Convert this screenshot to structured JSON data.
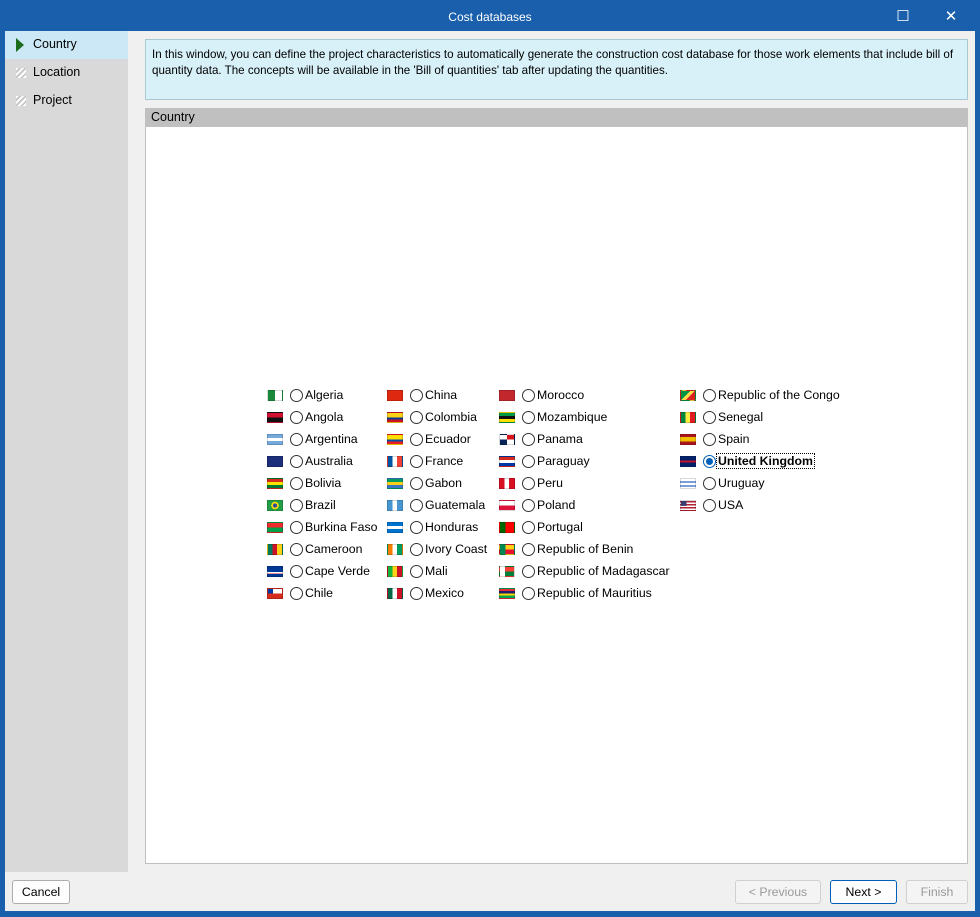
{
  "window": {
    "title": "Cost databases",
    "maximize_icon": "☐",
    "close_icon": "✕"
  },
  "sidebar": {
    "items": [
      {
        "label": "Country",
        "active": true
      },
      {
        "label": "Location"
      },
      {
        "label": "Project"
      }
    ]
  },
  "info_text": "In this window, you can define the project characteristics to automatically generate the construction cost database for those work elements that include bill of quantity data. The concepts will be available in the 'Bill of quantities' tab after updating the quantities.",
  "panel_title": "Country",
  "selected": "United Kingdom",
  "columns": [
    [
      {
        "name": "Algeria",
        "flag": "linear-gradient(90deg,#1a8a3a 50%,#fff 50%)"
      },
      {
        "name": "Angola",
        "flag": "linear-gradient(#d21034 50%,#111 50%)"
      },
      {
        "name": "Argentina",
        "flag": "linear-gradient(#75aadb 33%,#fff 33% 66%,#75aadb 66%)"
      },
      {
        "name": "Australia",
        "flag": "linear-gradient(#1d2e7a,#1d2e7a)"
      },
      {
        "name": "Bolivia",
        "flag": "linear-gradient(#d52b1e 33%,#f9e300 33% 66%,#007934 66%)"
      },
      {
        "name": "Brazil",
        "flag": "radial-gradient(circle,#2a4aa0 25%,#f5d90a 26% 45%,#229e45 46%)"
      },
      {
        "name": "Burkina Faso",
        "flag": "linear-gradient(#ef2b2d 50%,#009e49 50%)"
      },
      {
        "name": "Cameroon",
        "flag": "linear-gradient(90deg,#007a5e 33%,#ce1126 33% 66%,#fcd116 66%)"
      },
      {
        "name": "Cape Verde",
        "flag": "linear-gradient(#003893 55%,#fff 55% 70%,#cf2027 70% 78%,#003893 78%)"
      },
      {
        "name": "Chile",
        "flag": "linear-gradient(90deg,#0039a6 35%,#fff 35%) top/100% 50% no-repeat,linear-gradient(#d52b1e,#d52b1e)"
      }
    ],
    [
      {
        "name": "China",
        "flag": "linear-gradient(#de2910,#de2910)"
      },
      {
        "name": "Colombia",
        "flag": "linear-gradient(#fcd116 50%,#003893 50% 75%,#ce1126 75%)"
      },
      {
        "name": "Ecuador",
        "flag": "linear-gradient(#ffdd00 50%,#034ea2 50% 75%,#ed1c24 75%)"
      },
      {
        "name": "France",
        "flag": "linear-gradient(90deg,#0055a4 33%,#fff 33% 66%,#ef4135 66%)"
      },
      {
        "name": "Gabon",
        "flag": "linear-gradient(#009e60 33%,#fcd116 33% 66%,#3a75c4 66%)"
      },
      {
        "name": "Guatemala",
        "flag": "linear-gradient(90deg,#4997d0 33%,#fff 33% 66%,#4997d0 66%)"
      },
      {
        "name": "Honduras",
        "flag": "linear-gradient(#0073cf 33%,#fff 33% 66%,#0073cf 66%)"
      },
      {
        "name": "Ivory Coast",
        "flag": "linear-gradient(90deg,#f77f00 33%,#fff 33% 66%,#009e60 66%)"
      },
      {
        "name": "Mali",
        "flag": "linear-gradient(90deg,#14b53a 33%,#fcd116 33% 66%,#ce1126 66%)"
      },
      {
        "name": "Mexico",
        "flag": "linear-gradient(90deg,#006847 33%,#fff 33% 66%,#ce1126 66%)"
      }
    ],
    [
      {
        "name": "Morocco",
        "flag": "linear-gradient(#c1272d,#c1272d)"
      },
      {
        "name": "Mozambique",
        "flag": "linear-gradient(#009a44 33%,#111 33% 66%,#fce100 66%)"
      },
      {
        "name": "Panama",
        "flag": "linear-gradient(90deg,#fff 50%,#da121a 50%) top/100% 50% no-repeat,linear-gradient(90deg,#072357 50%,#fff 50%)"
      },
      {
        "name": "Paraguay",
        "flag": "linear-gradient(#d52b1e 33%,#fff 33% 66%,#0038a8 66%)"
      },
      {
        "name": "Peru",
        "flag": "linear-gradient(90deg,#d91023 33%,#fff 33% 66%,#d91023 66%)"
      },
      {
        "name": "Poland",
        "flag": "linear-gradient(#fff 50%,#dc143c 50%)"
      },
      {
        "name": "Portugal",
        "flag": "linear-gradient(90deg,#006600 40%,#ff0000 40%)"
      },
      {
        "name": "Republic of Benin",
        "flag": "linear-gradient(90deg,#008751 40%,transparent 40%),linear-gradient(#fcd116 50%,#e8112d 50%)"
      },
      {
        "name": "Republic of Madagascar",
        "flag": "linear-gradient(90deg,#fff 35%,transparent 35%),linear-gradient(#fc3d32 50%,#007e3a 50%)"
      },
      {
        "name": "Republic of Mauritius",
        "flag": "linear-gradient(#ea2839 25%,#1a206d 25% 50%,#ffd500 50% 75%,#00a551 75%)"
      }
    ],
    [
      {
        "name": "Republic of the Congo",
        "flag": "linear-gradient(135deg,#009543 40%,#fbde4a 40% 60%,#dc241f 60%)"
      },
      {
        "name": "Senegal",
        "flag": "linear-gradient(90deg,#00853f 33%,#fdef42 33% 66%,#e31b23 66%)"
      },
      {
        "name": "Spain",
        "flag": "linear-gradient(#aa151b 25%,#f1bf00 25% 75%,#aa151b 75%)"
      },
      {
        "name": "United Kingdom",
        "flag": "linear-gradient(#012169 40%,#c8102e 40% 60%,#012169 60%)"
      },
      {
        "name": "Uruguay",
        "flag": "repeating-linear-gradient(#fff 0 2px,#7b9fd6 2px 4px)"
      },
      {
        "name": "USA",
        "flag": "linear-gradient(90deg,#3c3b6e 40%,transparent 40%) top/100% 55% no-repeat,repeating-linear-gradient(#b22234 0 1.5px,#fff 1.5px 3px)"
      }
    ]
  ],
  "footer": {
    "cancel": "Cancel",
    "previous": "< Previous",
    "next": "Next >",
    "finish": "Finish"
  }
}
